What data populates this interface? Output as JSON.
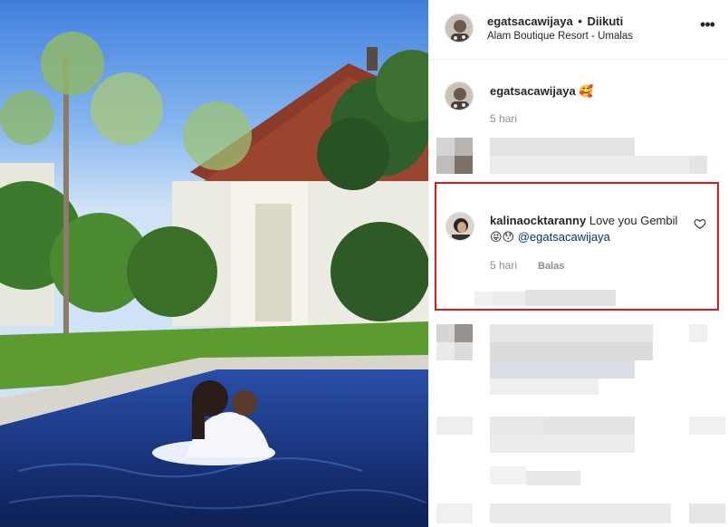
{
  "post": {
    "header": {
      "username": "egatsacawijaya",
      "separator": "•",
      "follow_status": "Diikuti",
      "location": "Alam Boutique Resort - Umalas",
      "more_label": "•••"
    },
    "caption": {
      "username": "egatsacawijaya",
      "emoji": "🥰",
      "time": "5 hari"
    },
    "highlighted_comment": {
      "username": "kalinaocktaranny",
      "text": "Love you Gembil",
      "emojis": "😝😯",
      "mention": "@egatsacawijaya",
      "time": "5 hari",
      "reply_label": "Balas",
      "highlight_color": "#e0191d"
    }
  },
  "colors": {
    "text_primary": "#262626",
    "text_secondary": "#8e8e8e",
    "mention": "#003569",
    "divider": "#efefef"
  }
}
